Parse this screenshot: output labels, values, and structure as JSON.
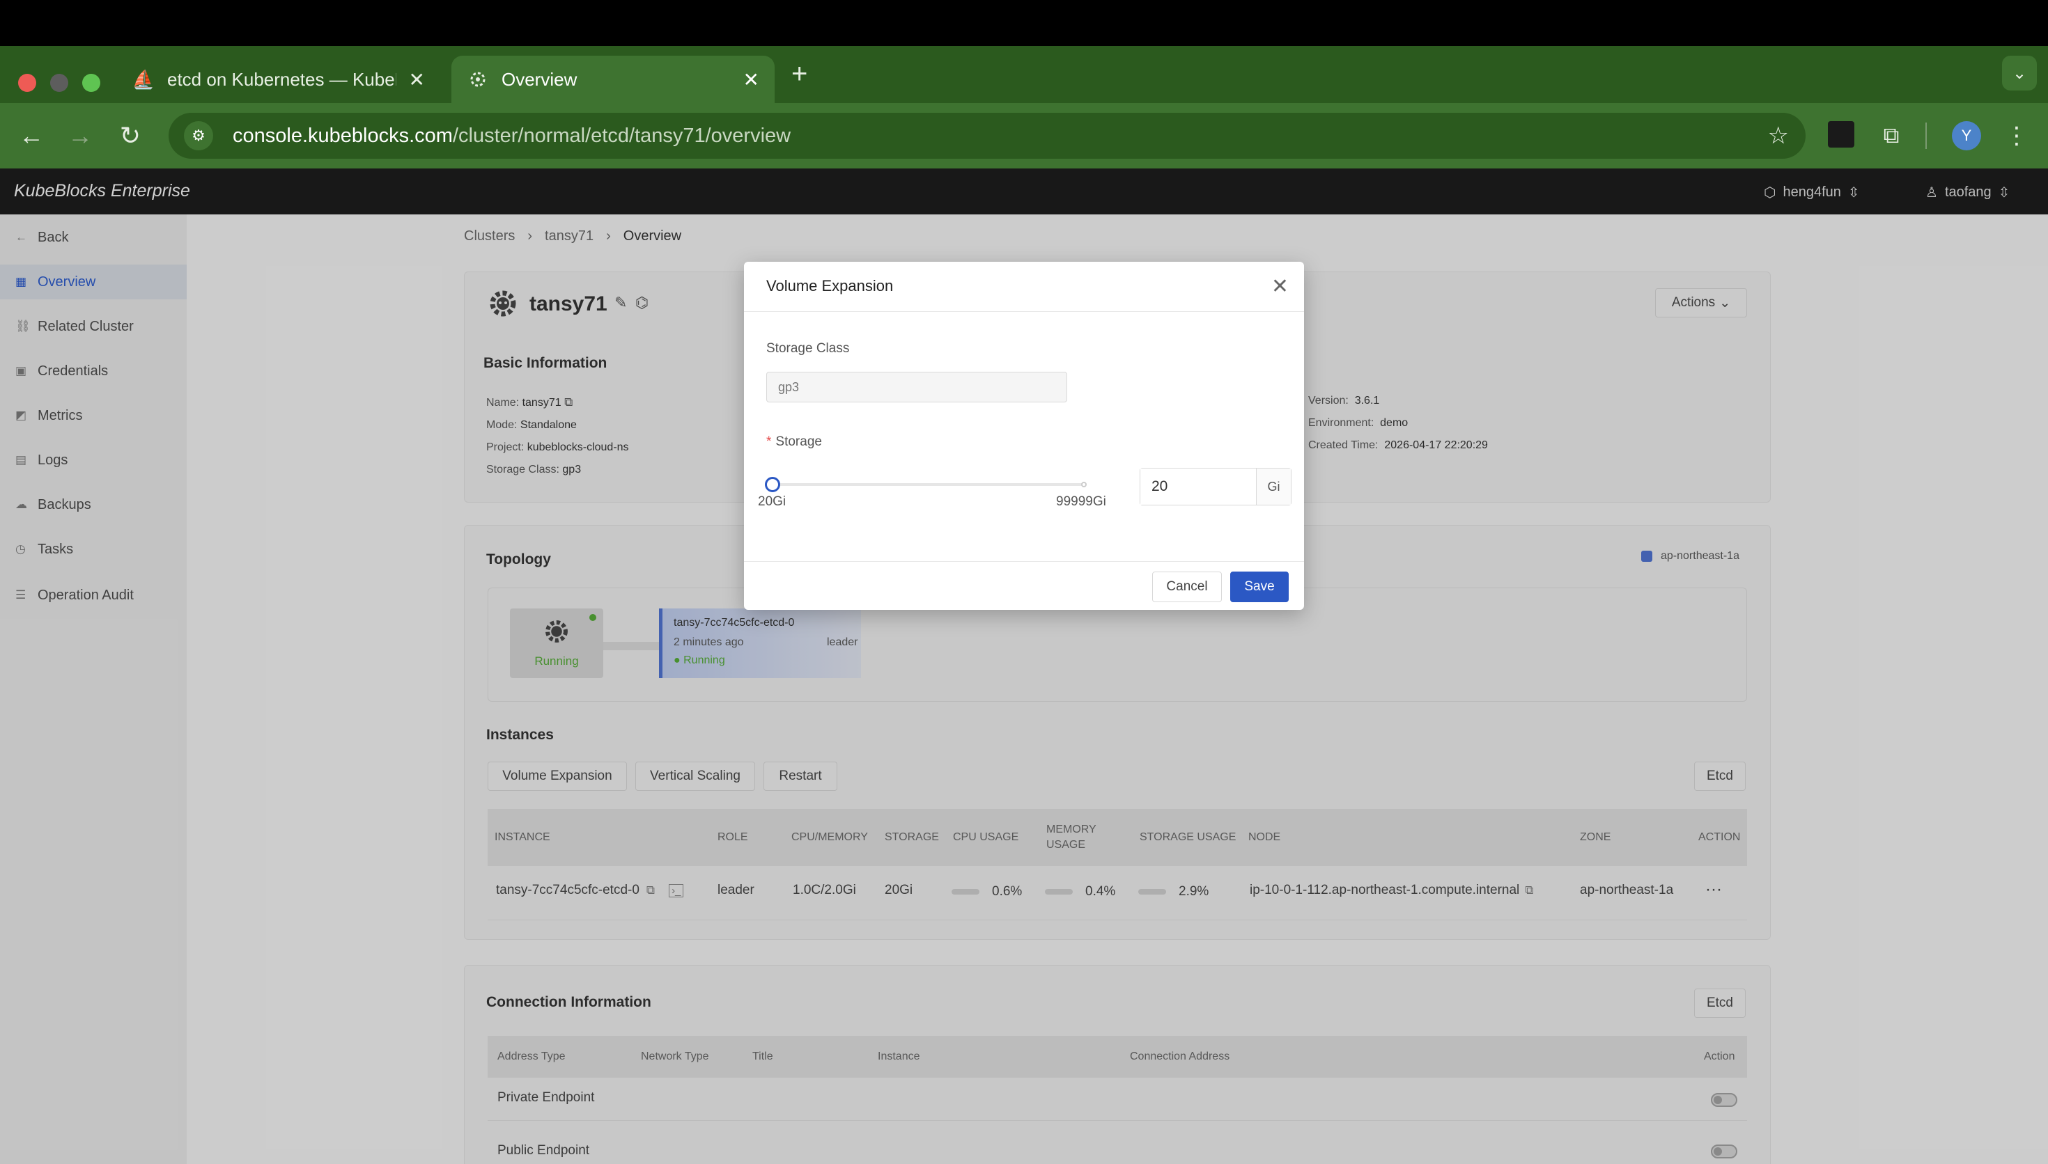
{
  "browser": {
    "tabs": [
      {
        "title": "etcd on Kubernetes — KubeBlocks",
        "active": false
      },
      {
        "title": "Overview",
        "active": true
      }
    ],
    "new_tab": "+",
    "url_host": "console.kubeblocks.com",
    "url_path": "/cluster/normal/etcd/tansy71/overview",
    "profile_initial": "Y"
  },
  "app": {
    "brand": "KubeBlocks Enterprise",
    "org": "heng4fun",
    "user": "taofang"
  },
  "sidebar": {
    "items": [
      {
        "label": "Back",
        "icon": "arrow-left-icon",
        "glyph": "←"
      },
      {
        "label": "Overview",
        "icon": "grid-icon",
        "glyph": "▦"
      },
      {
        "label": "Related Cluster",
        "icon": "link-icon",
        "glyph": "⛓"
      },
      {
        "label": "Credentials",
        "icon": "key-icon",
        "glyph": "▣"
      },
      {
        "label": "Metrics",
        "icon": "chart-icon",
        "glyph": "◩"
      },
      {
        "label": "Logs",
        "icon": "document-icon",
        "glyph": "▤"
      },
      {
        "label": "Backups",
        "icon": "cloud-icon",
        "glyph": "☁"
      },
      {
        "label": "Tasks",
        "icon": "clock-icon",
        "glyph": "◷"
      },
      {
        "label": "Operation Audit",
        "icon": "list-icon",
        "glyph": "☰"
      }
    ]
  },
  "breadcrumb": [
    "Clusters",
    "tansy71",
    "Overview"
  ],
  "cluster": {
    "name": "tansy71",
    "actions_label": "Actions",
    "basic_info_title": "Basic Information",
    "left_info": [
      {
        "k": "Name:",
        "v": "tansy71"
      },
      {
        "k": "Mode:",
        "v": "Standalone"
      },
      {
        "k": "Project:",
        "v": "kubeblocks-cloud-ns"
      },
      {
        "k": "Storage Class:",
        "v": "gp3"
      }
    ],
    "right_info": [
      {
        "k": "Version:",
        "v": "3.6.1"
      },
      {
        "k": "Environment:",
        "v": "demo"
      },
      {
        "k": "Created Time:",
        "v": "2026-04-17 22:20:29"
      }
    ]
  },
  "topology": {
    "title": "Topology",
    "legend": "ap-northeast-1a",
    "node_status": "Running",
    "pod_name": "tansy-7cc74c5cfc-etcd-0",
    "pod_age": "2 minutes ago",
    "pod_role": "leader",
    "pod_status": "Running"
  },
  "instances": {
    "title": "Instances",
    "buttons": [
      "Volume Expansion",
      "Vertical Scaling",
      "Restart"
    ],
    "component": "Etcd",
    "headers": [
      "INSTANCE",
      "ROLE",
      "CPU/MEMORY",
      "STORAGE",
      "CPU USAGE",
      "MEMORY USAGE",
      "STORAGE USAGE",
      "NODE",
      "ZONE",
      "ACTION"
    ],
    "row": {
      "instance": "tansy-7cc74c5cfc-etcd-0",
      "role": "leader",
      "cpu_memory": "1.0C/2.0Gi",
      "storage": "20Gi",
      "cpu_usage": "0.6%",
      "memory_usage": "0.4%",
      "storage_usage": "2.9%",
      "node": "ip-10-0-1-112.ap-northeast-1.compute.internal",
      "zone": "ap-northeast-1a",
      "action": "···"
    }
  },
  "connection": {
    "title": "Connection Information",
    "component": "Etcd",
    "headers": [
      "Address Type",
      "Network Type",
      "Title",
      "Instance",
      "Connection Address",
      "Action"
    ],
    "rows": [
      {
        "type": "Private Endpoint"
      },
      {
        "type": "Public Endpoint"
      }
    ]
  },
  "modal": {
    "title": "Volume Expansion",
    "storage_class_label": "Storage Class",
    "storage_class_placeholder": "gp3",
    "storage_label": "Storage",
    "required_mark": "*",
    "slider_min": "20Gi",
    "slider_max": "99999Gi",
    "slider_fraction": 0.0,
    "storage_value": "20",
    "storage_unit": "Gi",
    "cancel_label": "Cancel",
    "save_label": "Save"
  },
  "colors": {
    "accent": "#2b58c4",
    "running": "#52a436",
    "chrome_tab": "#3e7330"
  }
}
